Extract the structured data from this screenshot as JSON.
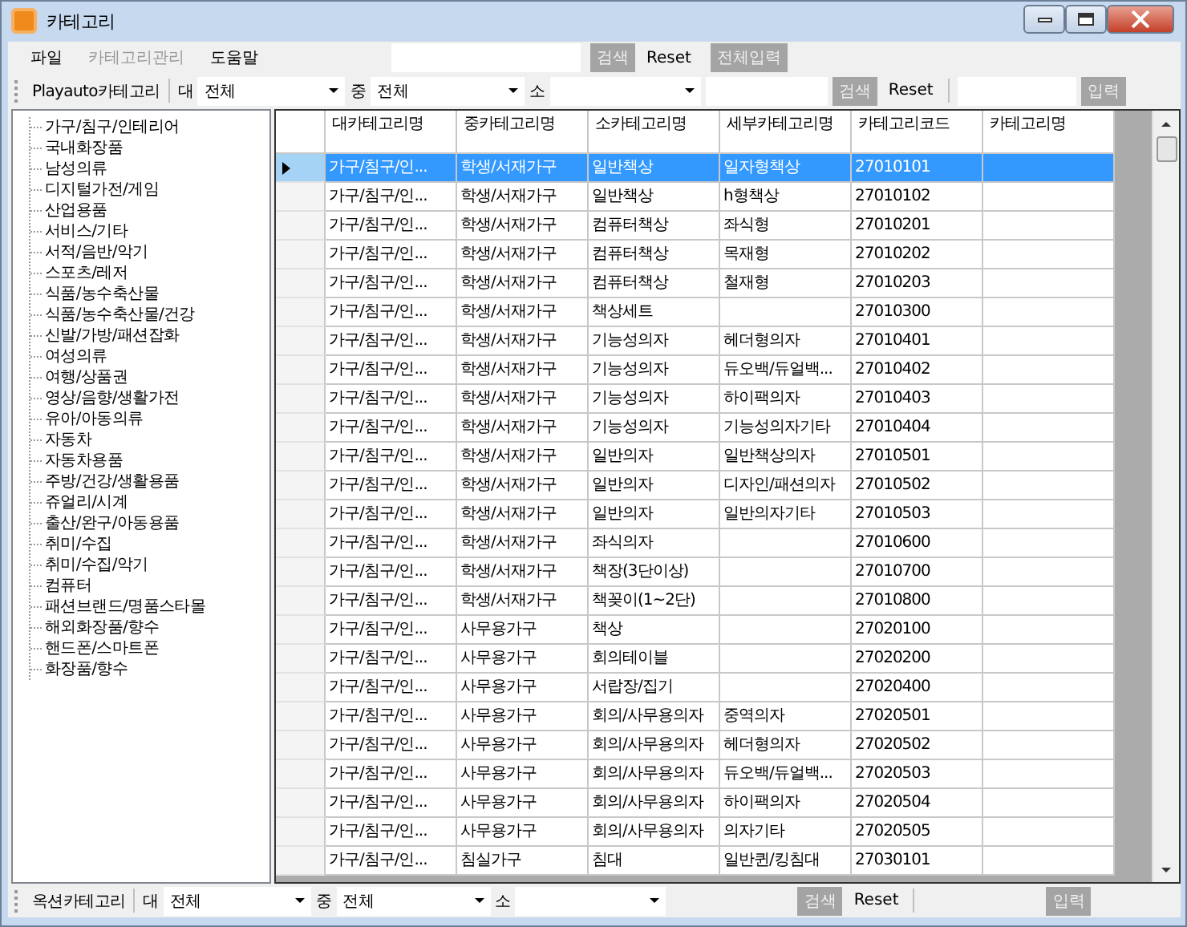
{
  "window": {
    "title": "카테고리"
  },
  "menu": [
    {
      "label": "파일",
      "disabled": false
    },
    {
      "label": "카테고리관리",
      "disabled": true
    },
    {
      "label": "도움말",
      "disabled": false
    }
  ],
  "top_bar": {
    "search_button": {
      "label": "검색",
      "disabled": true
    },
    "reset_button": "Reset",
    "input_all_button": {
      "label": "전체입력",
      "disabled": true
    }
  },
  "filter_bars": [
    {
      "source": "Playauto카테고리",
      "major_label": "대",
      "major_value": "전체",
      "middle_label": "중",
      "middle_value": "전체",
      "minor_label": "소",
      "text_fields": true,
      "search_button": {
        "label": "검색",
        "disabled": true
      },
      "reset_button": "Reset",
      "input_button": {
        "label": "입력",
        "disabled": true
      }
    },
    {
      "source": "옥션카테고리",
      "major_label": "대",
      "major_value": "전체",
      "middle_label": "중",
      "middle_value": "전체",
      "minor_label": "소",
      "text_fields": false,
      "search_button": {
        "label": "검색",
        "disabled": true
      },
      "reset_button": "Reset",
      "input_button": {
        "label": "입력",
        "disabled": true
      }
    }
  ],
  "category_tree": {
    "items": [
      {
        "label": "가구/침구/인테리어"
      },
      {
        "label": "국내화장품"
      },
      {
        "label": "남성의류"
      },
      {
        "label": "디지털가전/게임"
      },
      {
        "label": "산업용품"
      },
      {
        "label": "서비스/기타"
      },
      {
        "label": "서적/음반/악기"
      },
      {
        "label": "스포츠/레저"
      },
      {
        "label": "식품/농수축산물"
      },
      {
        "label": "식품/농수축산물/건강"
      },
      {
        "label": "신발/가방/패션잡화"
      },
      {
        "label": "여성의류"
      },
      {
        "label": "여행/상품권"
      },
      {
        "label": "영상/음향/생활가전"
      },
      {
        "label": "유아/아동의류"
      },
      {
        "label": "자동차"
      },
      {
        "label": "자동차용품"
      },
      {
        "label": "주방/건강/생활용품"
      },
      {
        "label": "쥬얼리/시계"
      },
      {
        "label": "출산/완구/아동용품"
      },
      {
        "label": "취미/수집"
      },
      {
        "label": "취미/수집/악기"
      },
      {
        "label": "컴퓨터"
      },
      {
        "label": "패션브랜드/명품스타몰"
      },
      {
        "label": "해외화장품/향수"
      },
      {
        "label": "핸드폰/스마트폰"
      },
      {
        "label": "화장품/향수"
      }
    ]
  },
  "table": {
    "columns": [
      "대카테고리명",
      "중카테고리명",
      "소카테고리명",
      "세부카테고리명",
      "카테고리코드",
      "카테고리명"
    ],
    "rows": [
      {
        "selected": true,
        "major": "가구/침구/인...",
        "middle": "학생/서재가구",
        "minor": "일반책상",
        "detail": "일자형책상",
        "code": "27010101"
      },
      {
        "selected": false,
        "major": "가구/침구/인...",
        "middle": "학생/서재가구",
        "minor": "일반책상",
        "detail": "h형책상",
        "code": "27010102"
      },
      {
        "selected": false,
        "major": "가구/침구/인...",
        "middle": "학생/서재가구",
        "minor": "컴퓨터책상",
        "detail": "좌식형",
        "code": "27010201"
      },
      {
        "selected": false,
        "major": "가구/침구/인...",
        "middle": "학생/서재가구",
        "minor": "컴퓨터책상",
        "detail": "목재형",
        "code": "27010202"
      },
      {
        "selected": false,
        "major": "가구/침구/인...",
        "middle": "학생/서재가구",
        "minor": "컴퓨터책상",
        "detail": "철재형",
        "code": "27010203"
      },
      {
        "selected": false,
        "major": "가구/침구/인...",
        "middle": "학생/서재가구",
        "minor": "책상세트",
        "code": "27010300"
      },
      {
        "selected": false,
        "major": "가구/침구/인...",
        "middle": "학생/서재가구",
        "minor": "기능성의자",
        "detail": "헤더형의자",
        "code": "27010401"
      },
      {
        "selected": false,
        "major": "가구/침구/인...",
        "middle": "학생/서재가구",
        "minor": "기능성의자",
        "detail": "듀오백/듀얼백...",
        "code": "27010402"
      },
      {
        "selected": false,
        "major": "가구/침구/인...",
        "middle": "학생/서재가구",
        "minor": "기능성의자",
        "detail": "하이팩의자",
        "code": "27010403"
      },
      {
        "selected": false,
        "major": "가구/침구/인...",
        "middle": "학생/서재가구",
        "minor": "기능성의자",
        "detail": "기능성의자기타",
        "code": "27010404"
      },
      {
        "selected": false,
        "major": "가구/침구/인...",
        "middle": "학생/서재가구",
        "minor": "일반의자",
        "detail": "일반책상의자",
        "code": "27010501"
      },
      {
        "selected": false,
        "major": "가구/침구/인...",
        "middle": "학생/서재가구",
        "minor": "일반의자",
        "detail": "디자인/패션의자",
        "code": "27010502"
      },
      {
        "selected": false,
        "major": "가구/침구/인...",
        "middle": "학생/서재가구",
        "minor": "일반의자",
        "detail": "일반의자기타",
        "code": "27010503"
      },
      {
        "selected": false,
        "major": "가구/침구/인...",
        "middle": "학생/서재가구",
        "minor": "좌식의자",
        "code": "27010600"
      },
      {
        "selected": false,
        "major": "가구/침구/인...",
        "middle": "학생/서재가구",
        "minor": "책장(3단이상)",
        "code": "27010700"
      },
      {
        "selected": false,
        "major": "가구/침구/인...",
        "middle": "학생/서재가구",
        "minor": "책꽂이(1~2단)",
        "code": "27010800"
      },
      {
        "selected": false,
        "major": "가구/침구/인...",
        "middle": "사무용가구",
        "minor": "책상",
        "code": "27020100"
      },
      {
        "selected": false,
        "major": "가구/침구/인...",
        "middle": "사무용가구",
        "minor": "회의테이블",
        "code": "27020200"
      },
      {
        "selected": false,
        "major": "가구/침구/인...",
        "middle": "사무용가구",
        "minor": "서랍장/집기",
        "code": "27020400"
      },
      {
        "selected": false,
        "major": "가구/침구/인...",
        "middle": "사무용가구",
        "minor": "회의/사무용의자",
        "detail": "중역의자",
        "code": "27020501"
      },
      {
        "selected": false,
        "major": "가구/침구/인...",
        "middle": "사무용가구",
        "minor": "회의/사무용의자",
        "detail": "헤더형의자",
        "code": "27020502"
      },
      {
        "selected": false,
        "major": "가구/침구/인...",
        "middle": "사무용가구",
        "minor": "회의/사무용의자",
        "detail": "듀오백/듀얼백...",
        "code": "27020503"
      },
      {
        "selected": false,
        "major": "가구/침구/인...",
        "middle": "사무용가구",
        "minor": "회의/사무용의자",
        "detail": "하이팩의자",
        "code": "27020504"
      },
      {
        "selected": false,
        "major": "가구/침구/인...",
        "middle": "사무용가구",
        "minor": "회의/사무용의자",
        "detail": "의자기타",
        "code": "27020505"
      },
      {
        "selected": false,
        "major": "가구/침구/인...",
        "middle": "침실가구",
        "minor": "침대",
        "detail": "일반퀸/킹침대",
        "code": "27030101"
      }
    ]
  }
}
